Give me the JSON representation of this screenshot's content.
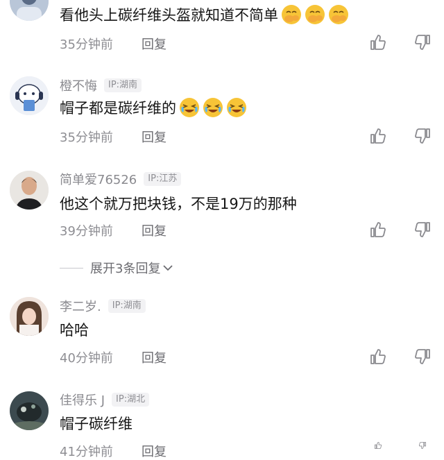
{
  "comments": [
    {
      "text": "看他头上碳纤维头盔就知道不简单",
      "emojis": [
        "covering-face-emoji",
        "covering-face-emoji",
        "covering-face-emoji"
      ],
      "time": "35分钟前",
      "reply": "回复"
    },
    {
      "username": "橙不悔",
      "ip": "IP:湖南",
      "text": "帽子都是碳纤维的",
      "emojis": [
        "laughing-crying-emoji",
        "laughing-crying-emoji",
        "laughing-crying-emoji"
      ],
      "time": "35分钟前",
      "reply": "回复"
    },
    {
      "username": "简单爱76526",
      "ip": "IP:江苏",
      "text": "他这个就万把块钱，不是19万的那种",
      "time": "39分钟前",
      "reply": "回复"
    },
    {
      "username": "李二岁.",
      "ip": "IP:湖南",
      "text": "哈哈",
      "time": "40分钟前",
      "reply": "回复"
    },
    {
      "username": "佳得乐 J",
      "ip": "IP:湖北",
      "text": "帽子碳纤维",
      "time": "41分钟前",
      "reply": "回复"
    }
  ],
  "expand_replies": {
    "label": "展开3条回复"
  },
  "icons": {
    "like": "thumbs-up-icon",
    "dislike": "thumbs-down-icon",
    "expand": "chevron-down-icon"
  },
  "colors": {
    "text": "#161616",
    "secondary": "#8e8e93",
    "badge_bg": "#f2f2f4"
  }
}
